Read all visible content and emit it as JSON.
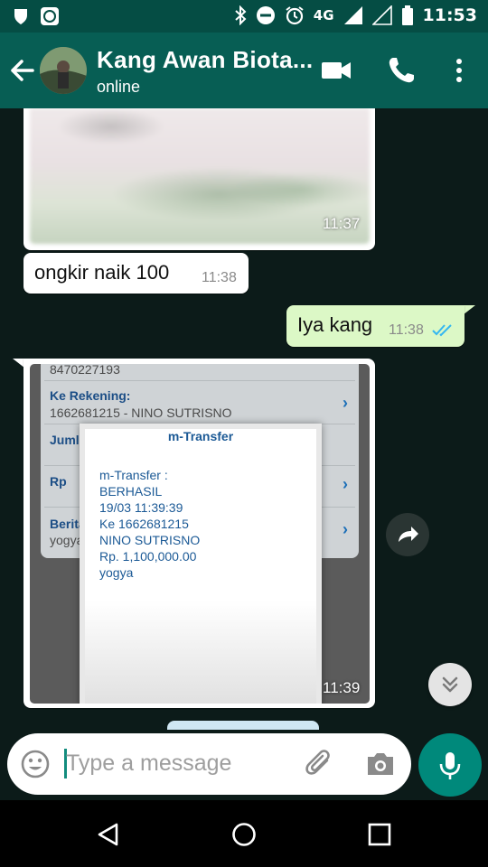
{
  "status_bar": {
    "network": "4G",
    "time": "11:53"
  },
  "header": {
    "contact_name": "Kang Awan Biota...",
    "status": "online"
  },
  "messages": [
    {
      "type": "image",
      "direction": "incoming",
      "time": "11:37"
    },
    {
      "type": "text",
      "direction": "incoming",
      "text": "ongkir naik 100",
      "time": "11:38"
    },
    {
      "type": "text",
      "direction": "outgoing",
      "text": "Iya kang",
      "time": "11:38",
      "ticks": "read"
    },
    {
      "type": "image",
      "direction": "incoming",
      "time": "11:39",
      "screenshot": {
        "account_top": "8470227193",
        "rows": [
          {
            "label": "Ke Rekening:",
            "value": "1662681215 - NINO SUTRISNO"
          },
          {
            "label": "Jumla",
            "value": ""
          },
          {
            "label": "Rp",
            "value": ""
          },
          {
            "label": "Berita",
            "value": "yogya"
          }
        ],
        "popup_title": "m-Transfer",
        "popup_lines": [
          "m-Transfer :",
          "BERHASIL",
          "19/03 11:39:39",
          "Ke 1662681215",
          "NINO SUTRISNO",
          "Rp. 1,100,000.00",
          "yogya"
        ]
      }
    }
  ],
  "composer": {
    "placeholder": "Type a message"
  },
  "colors": {
    "header": "#075e54",
    "statusbar": "#054d44",
    "accent": "#00897b",
    "outgoing_bubble": "#dcf8c6",
    "tick_blue": "#34b7f1"
  }
}
